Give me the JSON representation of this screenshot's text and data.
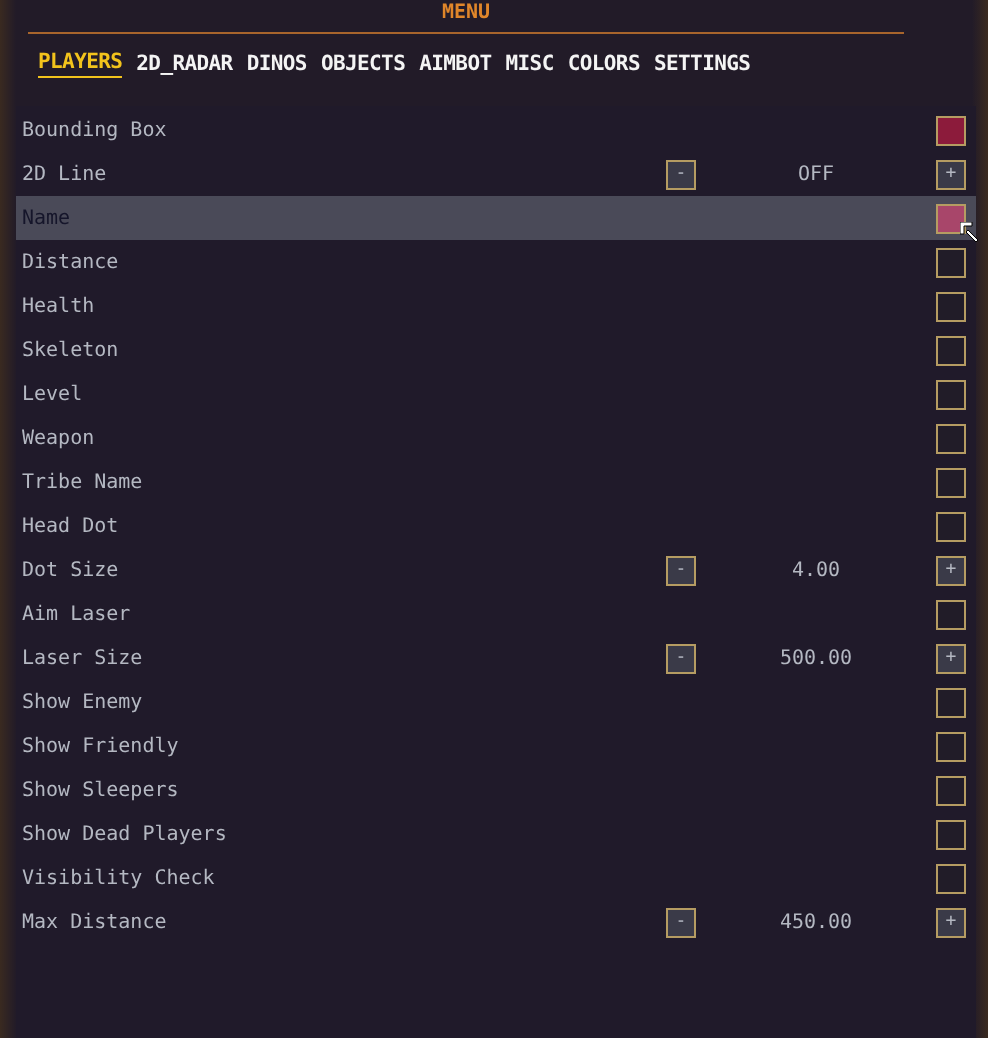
{
  "title": "MENU",
  "tabs": [
    {
      "label": "PLAYERS",
      "selected": true
    },
    {
      "label": "2D_RADAR",
      "selected": false
    },
    {
      "label": "DINOS",
      "selected": false
    },
    {
      "label": "OBJECTS",
      "selected": false
    },
    {
      "label": "AIMBOT",
      "selected": false
    },
    {
      "label": "MISC",
      "selected": false
    },
    {
      "label": "COLORS",
      "selected": false
    },
    {
      "label": "SETTINGS",
      "selected": false
    }
  ],
  "rows": [
    {
      "kind": "toggle",
      "label": "Bounding Box",
      "checked": true,
      "selected": false
    },
    {
      "kind": "stepper",
      "label": "2D Line",
      "decrement": "-",
      "value": "OFF",
      "increment": "+",
      "selected": false
    },
    {
      "kind": "toggle",
      "label": "Name",
      "checked": true,
      "selected": true
    },
    {
      "kind": "toggle",
      "label": "Distance",
      "checked": false,
      "selected": false
    },
    {
      "kind": "toggle",
      "label": "Health",
      "checked": false,
      "selected": false
    },
    {
      "kind": "toggle",
      "label": "Skeleton",
      "checked": false,
      "selected": false
    },
    {
      "kind": "toggle",
      "label": "Level",
      "checked": false,
      "selected": false
    },
    {
      "kind": "toggle",
      "label": "Weapon",
      "checked": false,
      "selected": false
    },
    {
      "kind": "toggle",
      "label": "Tribe Name",
      "checked": false,
      "selected": false
    },
    {
      "kind": "toggle",
      "label": "Head Dot",
      "checked": false,
      "selected": false
    },
    {
      "kind": "stepper",
      "label": "Dot Size",
      "decrement": "-",
      "value": "4.00",
      "increment": "+",
      "selected": false
    },
    {
      "kind": "toggle",
      "label": "Aim Laser",
      "checked": false,
      "selected": false
    },
    {
      "kind": "stepper",
      "label": "Laser Size",
      "decrement": "-",
      "value": "500.00",
      "increment": "+",
      "selected": false
    },
    {
      "kind": "toggle",
      "label": "Show Enemy",
      "checked": false,
      "selected": false
    },
    {
      "kind": "toggle",
      "label": "Show Friendly",
      "checked": false,
      "selected": false
    },
    {
      "kind": "toggle",
      "label": "Show Sleepers",
      "checked": false,
      "selected": false
    },
    {
      "kind": "toggle",
      "label": "Show Dead Players",
      "checked": false,
      "selected": false
    },
    {
      "kind": "toggle",
      "label": "Visibility Check",
      "checked": false,
      "selected": false
    },
    {
      "kind": "stepper",
      "label": "Max Distance",
      "decrement": "-",
      "value": "450.00",
      "increment": "+",
      "selected": false
    }
  ]
}
